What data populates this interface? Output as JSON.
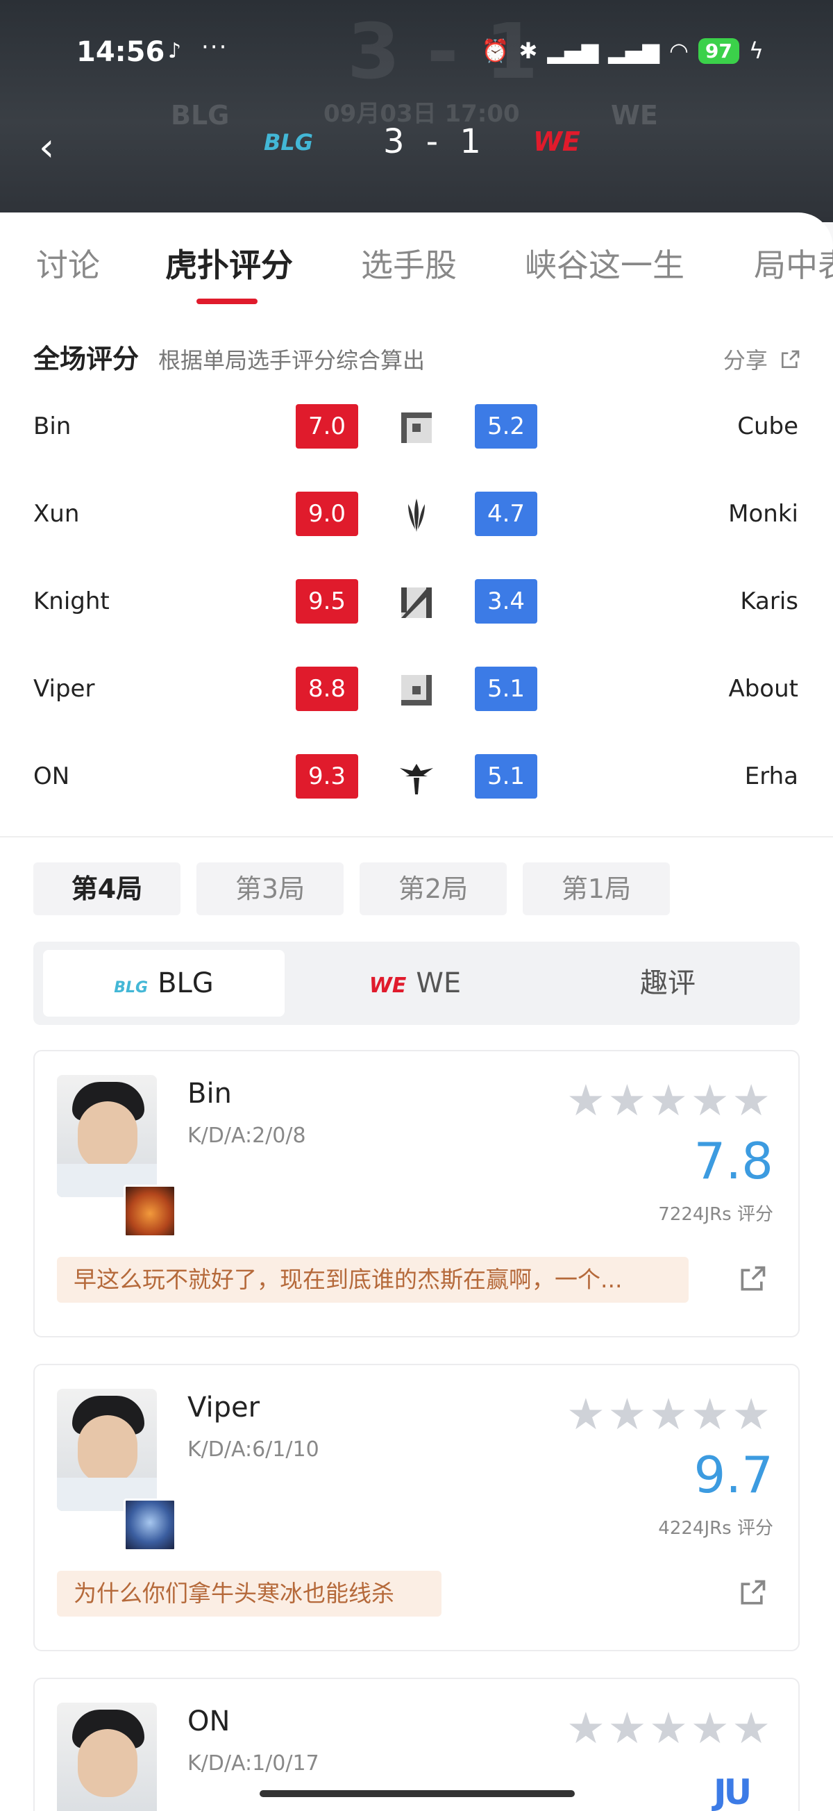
{
  "status_bar": {
    "time": "14:56",
    "tiktok_icon": "♪",
    "more": "···",
    "battery": "97"
  },
  "header": {
    "team_left": "BLG",
    "team_right": "WE",
    "score": "3 - 1",
    "match_time": "09月03日 17:00",
    "ghost_score": "3 - 1"
  },
  "tabs": [
    "讨论",
    "虎扑评分",
    "选手股",
    "峡谷这一生",
    "局中表"
  ],
  "ratings_section": {
    "title": "全场评分",
    "subtitle": "根据单局选手评分综合算出",
    "share": "分享",
    "rows": [
      {
        "left_player": "Bin",
        "left_score": "7.0",
        "role_icon": "top-lane-icon",
        "right_score": "5.2",
        "right_player": "Cube"
      },
      {
        "left_player": "Xun",
        "left_score": "9.0",
        "role_icon": "jungle-icon",
        "right_score": "4.7",
        "right_player": "Monki"
      },
      {
        "left_player": "Knight",
        "left_score": "9.5",
        "role_icon": "mid-lane-icon",
        "right_score": "3.4",
        "right_player": "Karis"
      },
      {
        "left_player": "Viper",
        "left_score": "8.8",
        "role_icon": "bot-lane-icon",
        "right_score": "5.1",
        "right_player": "About"
      },
      {
        "left_player": "ON",
        "left_score": "9.3",
        "role_icon": "support-icon",
        "right_score": "5.1",
        "right_player": "Erha"
      }
    ]
  },
  "games": [
    "第4局",
    "第3局",
    "第2局",
    "第1局"
  ],
  "segments": [
    "BLG",
    "WE",
    "趣评"
  ],
  "players": [
    {
      "name": "Bin",
      "kda": "K/D/A:2/0/8",
      "rating": "7.8",
      "votes": "7224JRs 评分",
      "comment": "早这么玩不就好了，现在到底谁的杰斯在赢啊，一个..."
    },
    {
      "name": "Viper",
      "kda": "K/D/A:6/1/10",
      "rating": "9.7",
      "votes": "4224JRs 评分",
      "comment": "为什么你们拿牛头寒冰也能线杀"
    },
    {
      "name": "ON",
      "kda": "K/D/A:1/0/17"
    }
  ],
  "stars": "★★★★★",
  "colors": {
    "red": "#e01b2c",
    "blue": "#3c7be6",
    "rating_blue": "#3c9be0",
    "comment_bg": "#fbeee4",
    "comment_text": "#b5693a"
  },
  "watermark": "JU"
}
